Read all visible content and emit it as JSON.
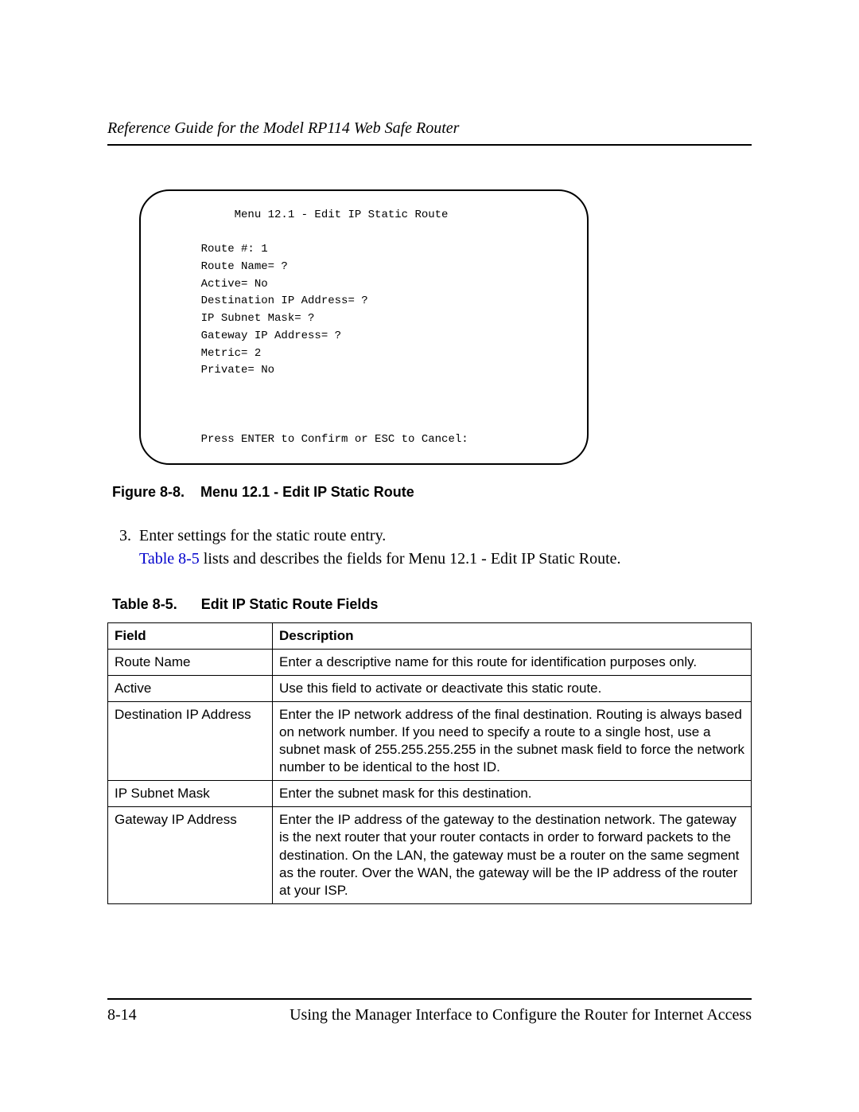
{
  "header": {
    "running": "Reference Guide for the Model RP114 Web Safe Router"
  },
  "figure": {
    "title_line": "              Menu 12.1 - Edit IP Static Route",
    "lines": [
      "         Route #: 1",
      "         Route Name= ?",
      "         Active= No",
      "         Destination IP Address= ?",
      "         IP Subnet Mask= ?",
      "         Gateway IP Address= ?",
      "         Metric= 2",
      "         Private= No"
    ],
    "prompt": "         Press ENTER to Confirm or ESC to Cancel:",
    "caption_ref": "Figure 8-8.",
    "caption_text": "Menu 12.1 - Edit IP Static Route"
  },
  "step": {
    "num": "3.",
    "text": "Enter settings for the static route entry.",
    "xref": "Table 8-5",
    "tail": " lists and describes the fields for Menu 12.1 - Edit IP Static Route."
  },
  "table": {
    "caption_ref": "Table 8-5.",
    "caption_text": "Edit IP Static Route Fields",
    "head": {
      "c1": "Field",
      "c2": "Description"
    },
    "rows": [
      {
        "c1": "Route Name",
        "c2": "Enter a descriptive name for this route for identification purposes only."
      },
      {
        "c1": "Active",
        "c2": "Use this field to activate or deactivate this static route."
      },
      {
        "c1": "Destination IP Address",
        "c2": "Enter the IP network address of the final destination. Routing is always based on network number. If you need to specify a route to a single host, use a subnet mask of 255.255.255.255 in the subnet mask field to force the network number to be identical to the host ID."
      },
      {
        "c1": "IP Subnet Mask",
        "c2": "Enter the subnet mask for this destination."
      },
      {
        "c1": "Gateway IP Address",
        "c2": "Enter the IP address of the gateway to the destination network. The gateway is the next router that your router contacts in order to forward packets to the destination. On the LAN, the gateway must be a router on the same segment as the router. Over the WAN, the gateway will be the IP address of the router at your ISP."
      }
    ]
  },
  "footer": {
    "left": "8-14",
    "right": "Using the Manager Interface to Configure the Router for Internet Access"
  }
}
